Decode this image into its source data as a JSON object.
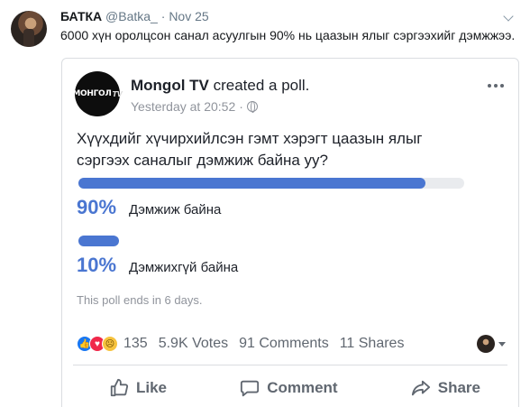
{
  "tweet": {
    "display_name": "БАТКА",
    "handle": "@Batka_",
    "separator": "·",
    "date": "Nov 25",
    "text": "6000 хүн оролцсон санал асуулгын 90% нь цаазын ялыг сэргээхийг дэмжжээ."
  },
  "post": {
    "page_logo_text": "МОНГОЛ",
    "page_logo_tv": "TV",
    "page_name": "Mongol TV",
    "action": " created a poll.",
    "timestamp": "Yesterday at 20:52",
    "meta_separator": "·",
    "question": "Хүүхдийг хүчирхийлсэн гэмт хэрэгт цаазын ялыг сэргээх саналыг дэмжиж байна уу?",
    "options": [
      {
        "percent_label": "90%",
        "label": "Дэмжиж байна",
        "fraction": 0.9
      },
      {
        "percent_label": "10%",
        "label": "Дэмжихгүй байна",
        "fraction": 0.1
      }
    ],
    "poll_note": "This poll ends in 6 days."
  },
  "stats": {
    "reaction_count": "135",
    "votes": "5.9K Votes",
    "comments": "91 Comments",
    "shares": "11 Shares"
  },
  "actions": {
    "like": "Like",
    "comment": "Comment",
    "share": "Share"
  },
  "colors": {
    "poll_accent": "#4a76d1",
    "like_blue": "#1877f2",
    "love_red": "#f0284a",
    "sad_yellow": "#f7c33e"
  }
}
